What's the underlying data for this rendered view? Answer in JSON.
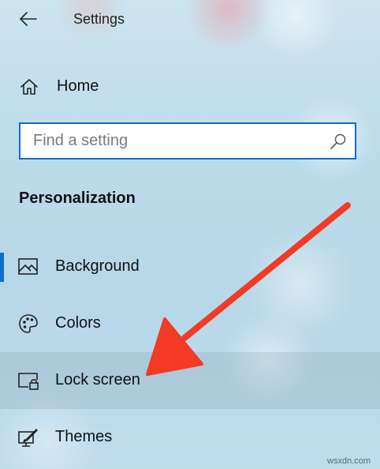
{
  "header": {
    "back_icon": "back-arrow-icon",
    "title": "Settings"
  },
  "home": {
    "icon": "home-icon",
    "label": "Home"
  },
  "search": {
    "placeholder": "Find a setting",
    "value": "",
    "icon": "search-icon"
  },
  "section": {
    "title": "Personalization"
  },
  "nav": {
    "items": [
      {
        "label": "Background",
        "icon": "picture-icon",
        "selected": true
      },
      {
        "label": "Colors",
        "icon": "palette-icon",
        "selected": false
      },
      {
        "label": "Lock screen",
        "icon": "lock-screen-icon",
        "selected": false,
        "hovered": true
      },
      {
        "label": "Themes",
        "icon": "themes-brush-icon",
        "selected": false
      }
    ]
  },
  "annotation": {
    "type": "arrow",
    "color": "#f23a25",
    "points_to": "Lock screen"
  },
  "colors": {
    "accent": "#0e6fc7",
    "annotation_red": "#f23a25"
  },
  "watermark": "wsxdn.com"
}
